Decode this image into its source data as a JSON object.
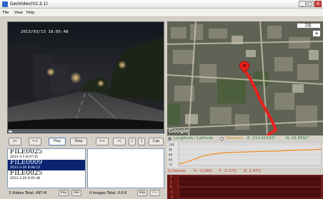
{
  "window": {
    "title": "GeoVideo(V2.2.1)",
    "buttons": [
      "_",
      "□",
      "X"
    ]
  },
  "menu": [
    "File",
    "View",
    "Help"
  ],
  "video": {
    "timestamp": "2013/03/13  18:05:48"
  },
  "controls": {
    "buttons": [
      "|<",
      "<<",
      "Play",
      "Stop",
      "<<",
      ">|",
      "[",
      "]",
      "Cap"
    ],
    "active": "Play"
  },
  "files": [
    {
      "name": "FILE0025",
      "date": "2013-3-1 8:07:35",
      "selected": false
    },
    {
      "name": "FILE0009",
      "date": "2013-3-26 8:06:12",
      "selected": true
    },
    {
      "name": "FILE0025",
      "date": "2013-3-26 8:05:48",
      "selected": false
    }
  ],
  "status": {
    "videos": "3 Videos Total: 497 M",
    "imp1": "Imp",
    "del1": "Del",
    "images": "0 Images Total: 0.0 K",
    "imp2": "Imp",
    "del2": "Del"
  },
  "map": {
    "type_label": "卫星",
    "zoom": "+",
    "brand": "Google",
    "route_color": "#e8211b",
    "marker_color": "#e8211b"
  },
  "coords": {
    "opt1": "Longitude / Latitude",
    "opt2": "Distance",
    "lon": "E: 114.01543°",
    "lat": "N: 22.6592°"
  },
  "altitude_plot": {
    "ticks": [
      "104",
      "96",
      "88",
      "80",
      "72"
    ],
    "line_color": "#f08a1c",
    "values": [
      73,
      78,
      85,
      89,
      91,
      92,
      92.5,
      93,
      93.5,
      94,
      95,
      95.5,
      96,
      97
    ]
  },
  "gsensor": {
    "label": "G-Sensor",
    "x": "X: -0.08G",
    "y": "Y: -0.27G",
    "z": "Z: 1.47G",
    "ticks": [
      "2",
      "1",
      "0",
      "-1",
      "-2"
    ]
  }
}
